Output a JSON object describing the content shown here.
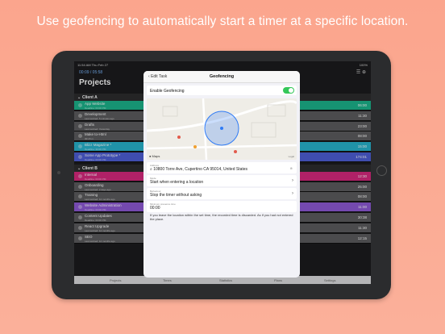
{
  "headline": "Use geofencing to automatically start a timer at a specific location.",
  "status": {
    "time": "11:54 AM",
    "date": "Thu Feb 27",
    "right": "100%"
  },
  "sidebar": {
    "timer": "00:09 / 05:58",
    "title": "Projects",
    "groups": [
      {
        "name": "Client A",
        "rows": [
          {
            "name": "App Website",
            "sub": "Deadline: 03:00 PM",
            "value": "06:00",
            "color": "#1bb48c"
          },
          {
            "name": "Development",
            "sub": "Last worked: 5 minutes ago",
            "value": "11:30",
            "color": "#5c5c5e"
          },
          {
            "name": "Drafts",
            "sub": "Last worked: Yesterday",
            "value": "23:00",
            "color": "#5c5c5e"
          },
          {
            "name": "Make to-Html",
            "sub": "30:15 m",
            "value": "08:00",
            "color": "#5c5c5e"
          },
          {
            "name": "Blizz Magazine *",
            "sub": "Deadline: 30:00 PM",
            "value": "15:00",
            "color": "#28b4ce"
          },
          {
            "name": "Some App Prototype *",
            "sub": "Deadline: 03:00 PM",
            "value": "174:01",
            "color": "#4e5fd6"
          }
        ]
      },
      {
        "name": "Client B",
        "rows": [
          {
            "name": "Internal",
            "sub": "Deadline: 03:00 PM",
            "value": "12:30",
            "color": "#d7297e"
          },
          {
            "name": "Onboarding",
            "sub": "Last worked: 2 days ago",
            "value": "25:00",
            "color": "#5c5c5e"
          },
          {
            "name": "Training",
            "sub": "Last worked: 12 months ago",
            "value": "08:00",
            "color": "#5c5c5e"
          },
          {
            "name": "Website Administration",
            "sub": "Deadline: 03:00 PM",
            "value": "11:00",
            "color": "#8e5ad6"
          },
          {
            "name": "Content Updates",
            "sub": "Deadline: 03:00 PM",
            "value": "30:38",
            "color": "#5c5c5e"
          },
          {
            "name": "React Upgrade",
            "sub": "Last worked: 12 months ago",
            "value": "11:30",
            "color": "#5c5c5e"
          },
          {
            "name": "SEO",
            "sub": "Last worked: 12 months ago",
            "value": "12:15",
            "color": "#5c5c5e"
          }
        ]
      }
    ]
  },
  "tabbar": [
    "Projects",
    "Times",
    "Statistics",
    "Plans",
    "Settings"
  ],
  "modal": {
    "back": "Edit Task",
    "title": "Geofencing",
    "enable_label": "Enable Geofencing",
    "enabled": true,
    "map_label": "Maps",
    "map_legal": "Legal",
    "address_caption": "Address",
    "address": "10800 Torre Ave, Cupertino CA 95014, United States",
    "mode_caption": "Mode",
    "mode": "Start when entering a location",
    "behaviour_caption": "Behaviour",
    "behaviour": "Stop the timer without asking",
    "min_caption": "Minimum presence time",
    "min_time": "00:00",
    "note": "If you leave the location within the set time, the recorded time is discarded. As if you had not entered the place."
  },
  "colors": {
    "accent": "#34c759",
    "region": "#2f7bf5",
    "background": "#fba58d"
  }
}
